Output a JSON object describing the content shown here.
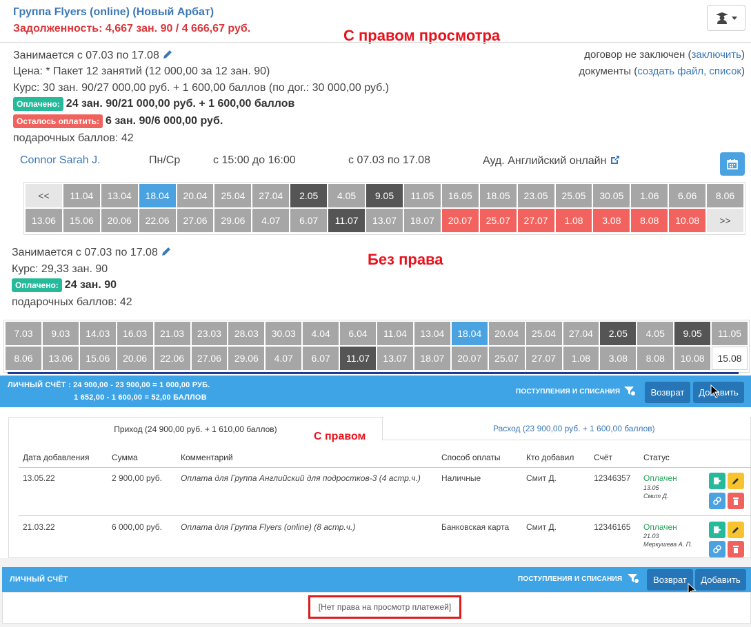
{
  "header": {
    "title": "Группа Flyers (online) (Новый Арбат)",
    "debt": "Задолженность: 4,667 зан. 90 / 4 666,67 руб."
  },
  "notes": {
    "with_view": "С правом просмотра",
    "without": "Без права",
    "with_right": "С правом"
  },
  "top": {
    "period": "Занимается с 07.03 по 17.08",
    "price": "Цена: * Пакет 12 занятий (12 000,00 за 12 зан. 90)",
    "course": "Курс: 30 зан. 90/27 000,00 руб. + 1 600,00 баллов (по дог.: 30 000,00 руб.)",
    "paid_badge": "Оплачено:",
    "paid_value": "24 зан. 90/21 000,00 руб. + 1 600,00 баллов",
    "left_badge": "Осталось оплатить:",
    "left_value": "6 зан. 90/6 000,00 руб.",
    "gift": "подарочных баллов: 42",
    "contract_text": "договор не заключен (",
    "contract_link": "заключить",
    "close": ")",
    "docs_text": "документы (",
    "docs_link": "создать файл, список",
    "docs_close": ")"
  },
  "teacher": {
    "name": "Connor Sarah J.",
    "days": "Пн/Ср",
    "time": "с 15:00 до 16:00",
    "period": "с 07.03 по 17.08",
    "room": "Ауд. Английский онлайн"
  },
  "grid1": [
    [
      [
        "<<",
        "light"
      ],
      [
        "11.04",
        "g"
      ],
      [
        "13.04",
        "g"
      ],
      [
        "18.04",
        "blue"
      ],
      [
        "20.04",
        "g"
      ],
      [
        "25.04",
        "g"
      ],
      [
        "27.04",
        "g"
      ],
      [
        "2.05",
        "dark"
      ],
      [
        "4.05",
        "g"
      ],
      [
        "9.05",
        "dark"
      ],
      [
        "11.05",
        "g"
      ],
      [
        "16.05",
        "g"
      ],
      [
        "18.05",
        "g"
      ],
      [
        "23.05",
        "g"
      ],
      [
        "25.05",
        "g"
      ],
      [
        "30.05",
        "g"
      ],
      [
        "1.06",
        "g"
      ],
      [
        "6.06",
        "g"
      ],
      [
        "8.06",
        "g"
      ]
    ],
    [
      [
        "13.06",
        "g"
      ],
      [
        "15.06",
        "g"
      ],
      [
        "20.06",
        "g"
      ],
      [
        "22.06",
        "g"
      ],
      [
        "27.06",
        "g"
      ],
      [
        "29.06",
        "g"
      ],
      [
        "4.07",
        "g"
      ],
      [
        "6.07",
        "g"
      ],
      [
        "11.07",
        "dark"
      ],
      [
        "13.07",
        "g"
      ],
      [
        "18.07",
        "g"
      ],
      [
        "20.07",
        "red"
      ],
      [
        "25.07",
        "red"
      ],
      [
        "27.07",
        "red"
      ],
      [
        "1.08",
        "red"
      ],
      [
        "3.08",
        "red"
      ],
      [
        "8.08",
        "red"
      ],
      [
        "10.08",
        "red"
      ],
      [
        ">>",
        "light"
      ]
    ]
  ],
  "mid": {
    "period": "Занимается с 07.03 по 17.08",
    "course": "Курс: 29,33 зан. 90",
    "paid_badge": "Оплачено:",
    "paid_value": "24 зан. 90",
    "gift": "подарочных баллов: 42"
  },
  "grid2": [
    [
      [
        "7.03",
        "g"
      ],
      [
        "9.03",
        "g"
      ],
      [
        "14.03",
        "g"
      ],
      [
        "16.03",
        "g"
      ],
      [
        "21.03",
        "g"
      ],
      [
        "23.03",
        "g"
      ],
      [
        "28.03",
        "g"
      ],
      [
        "30.03",
        "g"
      ],
      [
        "4.04",
        "g"
      ],
      [
        "6.04",
        "g"
      ],
      [
        "11.04",
        "g"
      ],
      [
        "13.04",
        "g"
      ],
      [
        "18.04",
        "blue"
      ],
      [
        "20.04",
        "g"
      ],
      [
        "25.04",
        "g"
      ],
      [
        "27.04",
        "g"
      ],
      [
        "2.05",
        "dark"
      ],
      [
        "4.05",
        "g"
      ],
      [
        "9.05",
        "dark"
      ],
      [
        "11.05",
        "g"
      ]
    ],
    [
      [
        "8.06",
        "g"
      ],
      [
        "13.06",
        "g"
      ],
      [
        "15.06",
        "g"
      ],
      [
        "20.06",
        "g"
      ],
      [
        "22.06",
        "g"
      ],
      [
        "27.06",
        "g"
      ],
      [
        "29.06",
        "g"
      ],
      [
        "4.07",
        "g"
      ],
      [
        "6.07",
        "g"
      ],
      [
        "11.07",
        "dark"
      ],
      [
        "13.07",
        "g"
      ],
      [
        "18.07",
        "g"
      ],
      [
        "20.07",
        "g"
      ],
      [
        "25.07",
        "g"
      ],
      [
        "27.07",
        "g"
      ],
      [
        "1.08",
        "g"
      ],
      [
        "3.08",
        "g"
      ],
      [
        "8.08",
        "g"
      ],
      [
        "10.08",
        "g"
      ],
      [
        "15.08",
        "white"
      ]
    ]
  ],
  "account1": {
    "line1": "ЛИЧНЫЙ СЧЁТ : 24 900,00 - 23 900,00 = 1 000,00 РУБ.",
    "line2": "1 652,00 - 1 600,00 = 52,00 БАЛЛОВ",
    "flows": "ПОСТУПЛЕНИЯ И СПИСАНИЯ",
    "refund": "Возврат",
    "add": "Добавить"
  },
  "tabs": {
    "income": "Приход (24 900,00 руб. + 1 610,00 баллов)",
    "expense": "Расход (23 900,00 руб. + 1 600,00 баллов)"
  },
  "table": {
    "headers": [
      "Дата добавления",
      "Сумма",
      "Комментарий",
      "Способ оплаты",
      "Кто добавил",
      "Счёт",
      "Статус"
    ],
    "rows": [
      {
        "date": "13.05.22",
        "sum": "2 900,00 руб.",
        "comment": "Оплата для Группа Английский для подростков-3 (4 астр.ч.)",
        "method": "Наличные",
        "who": "Смит Д.",
        "acc": "12346357",
        "status": "Оплачен",
        "sdate": "13.05",
        "sby": "Смит Д."
      },
      {
        "date": "21.03.22",
        "sum": "6 000,00 руб.",
        "comment": "Оплата для Группа Flyers (online) (8 астр.ч.)",
        "method": "Банковская карта",
        "who": "Смит Д.",
        "acc": "12346165",
        "status": "Оплачен",
        "sdate": "21.03",
        "sby": "Меркушева А. П."
      }
    ]
  },
  "account2": {
    "title": "ЛИЧНЫЙ СЧЁТ",
    "flows": "ПОСТУПЛЕНИЯ И СПИСАНИЯ",
    "refund": "Возврат",
    "add": "Добавить",
    "noright": "[Нет права на просмотр платежей]"
  },
  "colors": {
    "green": "#26b99a",
    "red": "#f0625d",
    "blue": "#4ba2e0",
    "bar": "#3ea4e6",
    "dark": "#2575b7"
  }
}
